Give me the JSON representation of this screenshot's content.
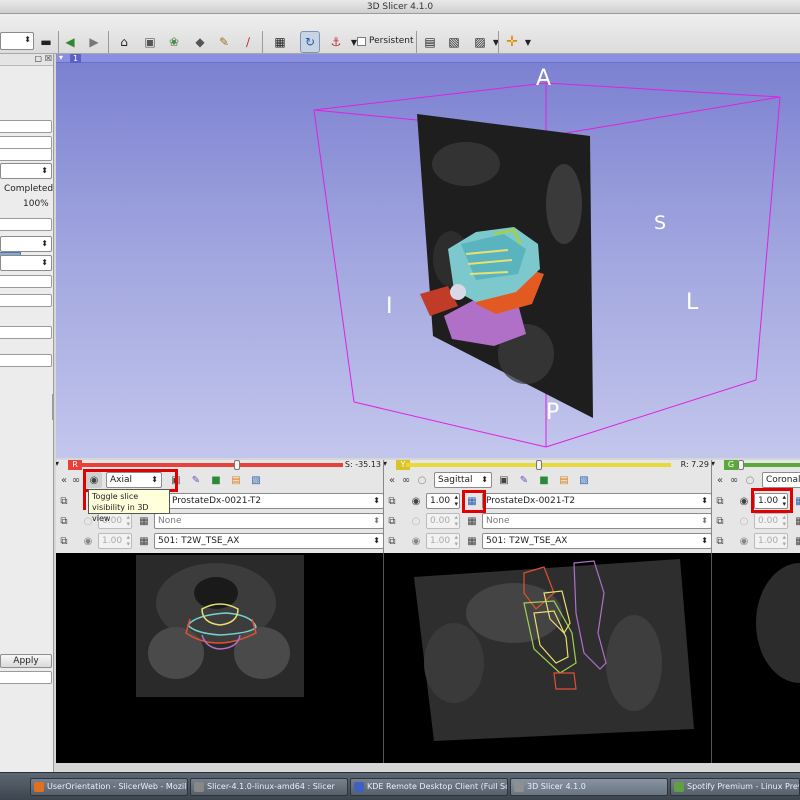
{
  "window": {
    "title": "3D Slicer 4.1.0"
  },
  "toolbar": {
    "persistent_label": "Persistent",
    "icons": [
      "module-combo",
      "back-arrow-icon",
      "forward-arrow-icon",
      "home-icon",
      "data-icon",
      "volumes-icon",
      "models-icon",
      "editor-icon",
      "transforms-icon",
      "layout-icon",
      "reset-view-icon",
      "crosshair-place-icon",
      "screenshot-icon",
      "scene-view-icon",
      "capture-icon",
      "crosshair-icon"
    ]
  },
  "left_panel": {
    "status_text": "Completed",
    "progress_text": "100%",
    "progress_value": 1.0,
    "apply_label": "Apply"
  },
  "view3d": {
    "label": "1",
    "orientation": {
      "top": "A",
      "right": "S",
      "far_right": "L",
      "left": "I",
      "bottom": "P"
    },
    "colors": {
      "bbox": "#e020e0",
      "bg_top": "#7a7fd0",
      "bg_bottom": "#c3c6ec"
    }
  },
  "slices": [
    {
      "id": "red",
      "letter": "R",
      "color": "#e8403a",
      "offset": "S: -35.13",
      "orientation": "Axial",
      "foreground_opacity": "",
      "foreground": "ProstateDx-0021-T2",
      "label_opacity": "0.00",
      "label": "None",
      "background_opacity": "1.00",
      "background": "501: T2W_TSE_AX",
      "slider_position": 0.6
    },
    {
      "id": "yellow",
      "letter": "Y",
      "color": "#e8d838",
      "offset": "R: 7.29",
      "orientation": "Sagittal",
      "foreground_opacity": "1.00",
      "foreground": "ProstateDx-0021-T2",
      "label_opacity": "0.00",
      "label": "None",
      "background_opacity": "1.00",
      "background": "501: T2W_TSE_AX",
      "slider_position": 0.5
    },
    {
      "id": "green",
      "letter": "G",
      "color": "#5aa83c",
      "offset": "",
      "orientation": "Coronal",
      "foreground_opacity": "1.00",
      "foreground": "",
      "label_opacity": "0.00",
      "label": "",
      "background_opacity": "1.00",
      "background": "",
      "slider_position": 0.1
    }
  ],
  "tooltip": {
    "line1": "Toggle slice",
    "line2": "visibility in 3D view"
  },
  "taskbar": {
    "items": [
      {
        "label": "UserOrientation - SlicerWeb - Mozill",
        "icon_color": "#e07020"
      },
      {
        "label": "Slicer-4.1.0-linux-amd64 : Slicer",
        "icon_color": "#888888"
      },
      {
        "label": "KDE Remote Desktop Client (Full Scr",
        "icon_color": "#4060c0"
      },
      {
        "label": "3D Slicer 4.1.0",
        "icon_color": "#909090"
      },
      {
        "label": "Spotify Premium - Linux Preview",
        "icon_color": "#60a040"
      }
    ]
  }
}
